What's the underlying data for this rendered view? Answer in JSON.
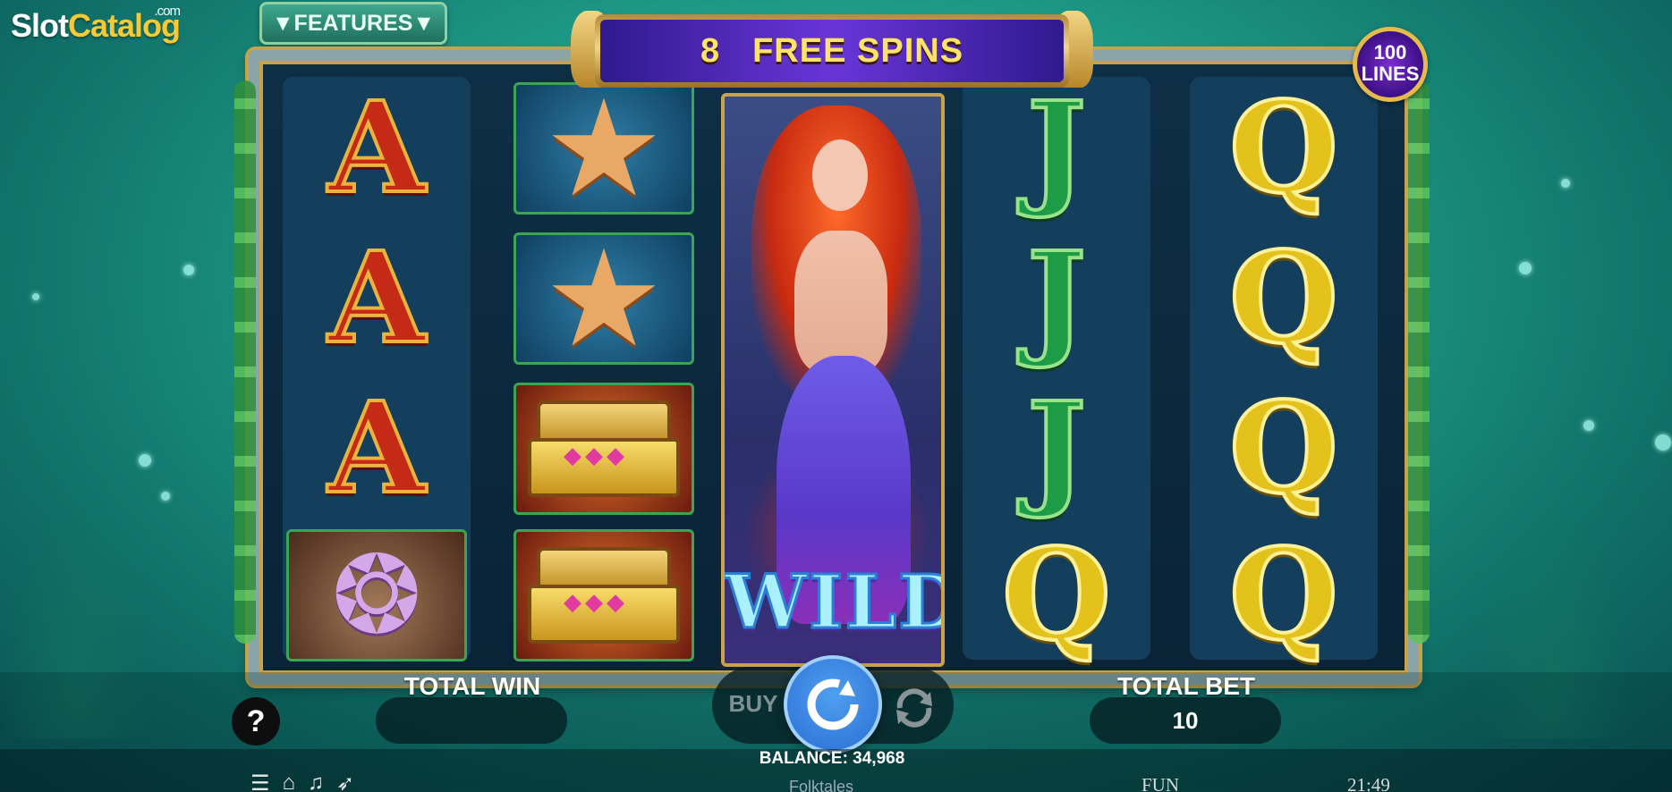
{
  "logo": {
    "main_white": "Slot",
    "main_gold": "Catalog",
    "suffix": ".com"
  },
  "features_button": {
    "label": "▼FEATURES▼"
  },
  "free_spins": {
    "count": "8",
    "label": "FREE SPINS"
  },
  "lines_badge": {
    "count": "100",
    "label": "LINES"
  },
  "reels": {
    "reel1": [
      "A",
      "A",
      "A",
      "pearl-clam"
    ],
    "reel2": [
      "starfish",
      "starfish",
      "treasure-chest",
      "treasure-chest"
    ],
    "reel3": [
      "mermaid-wild"
    ],
    "reel4": [
      "J",
      "J",
      "J",
      "Q"
    ],
    "reel5": [
      "Q",
      "Q",
      "Q",
      "Q"
    ],
    "wild_label": "WILD"
  },
  "bottom": {
    "help_label": "?",
    "total_win_label": "TOTAL WIN",
    "total_win_value": "",
    "buy_label": "BUY",
    "total_bet_label": "TOTAL BET",
    "total_bet_value": "10",
    "balance_text": "BALANCE: 34,968"
  },
  "status_bar": {
    "icons": [
      "menu-icon",
      "home-icon",
      "sound-icon",
      "turbo-icon"
    ],
    "provider": "Folktales",
    "mode": "FUN",
    "time": "21:49"
  },
  "colors": {
    "background": "#1d9886",
    "frame_gold": "#c6a24a",
    "banner_purple": "#6a35d8",
    "spin_blue": "#2a6fd4"
  }
}
